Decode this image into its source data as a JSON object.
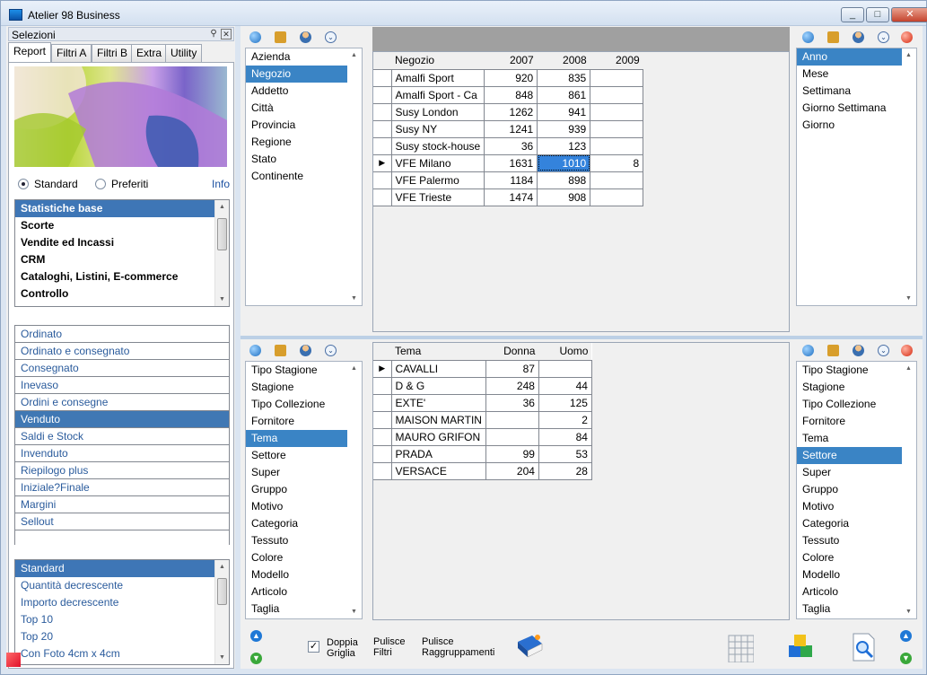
{
  "window": {
    "title": "Atelier 98 Business"
  },
  "left": {
    "header": "Selezioni",
    "tabs": [
      "Report",
      "Filtri A",
      "Filtri B",
      "Extra",
      "Utility"
    ],
    "radios": {
      "standard": "Standard",
      "preferiti": "Preferiti",
      "info": "Info"
    },
    "categories": [
      "Statistiche base",
      "Scorte",
      "Vendite ed Incassi",
      "CRM",
      "Cataloghi, Listini, E-commerce",
      "Controllo"
    ],
    "reports": [
      "Ordinato",
      "Ordinato e consegnato",
      "Consegnato",
      "Inevaso",
      "Ordini e consegne",
      "Venduto",
      "Saldi e Stock",
      "Invenduto",
      "Riepilogo plus",
      "Iniziale?Finale",
      "Margini",
      "Sellout"
    ],
    "sorts": [
      "Standard",
      "Quantità decrescente",
      "Importo decrescente",
      "Top 10",
      "Top 20",
      "Con Foto 4cm x 4cm"
    ]
  },
  "top": {
    "row_fields": [
      "Azienda",
      "Negozio",
      "Addetto",
      "Città",
      "Provincia",
      "Regione",
      "Stato",
      "Continente"
    ],
    "col_fields": [
      "Anno",
      "Mese",
      "Settimana",
      "Giorno Settimana",
      "Giorno"
    ],
    "grid": {
      "headers": [
        "Negozio",
        "2007",
        "2008",
        "2009"
      ],
      "rows": [
        [
          "Amalfi Sport",
          "920",
          "835",
          ""
        ],
        [
          "Amalfi Sport - Ca",
          "848",
          "861",
          ""
        ],
        [
          "Susy London",
          "1262",
          "941",
          ""
        ],
        [
          "Susy NY",
          "1241",
          "939",
          ""
        ],
        [
          "Susy stock-house",
          "36",
          "123",
          ""
        ],
        [
          "VFE Milano",
          "1631",
          "1010",
          "8"
        ],
        [
          "VFE Palermo",
          "1184",
          "898",
          ""
        ],
        [
          "VFE Trieste",
          "1474",
          "908",
          ""
        ]
      ]
    }
  },
  "bottom": {
    "row_fields": [
      "Tipo Stagione",
      "Stagione",
      "Tipo Collezione",
      "Fornitore",
      "Tema",
      "Settore",
      "Super",
      "Gruppo",
      "Motivo",
      "Categoria",
      "Tessuto",
      "Colore",
      "Modello",
      "Articolo",
      "Taglia"
    ],
    "col_fields": [
      "Tipo Stagione",
      "Stagione",
      "Tipo Collezione",
      "Fornitore",
      "Tema",
      "Settore",
      "Super",
      "Gruppo",
      "Motivo",
      "Categoria",
      "Tessuto",
      "Colore",
      "Modello",
      "Articolo",
      "Taglia"
    ],
    "grid": {
      "headers": [
        "Tema",
        "Donna",
        "Uomo"
      ],
      "rows": [
        [
          "CAVALLI",
          "87",
          ""
        ],
        [
          "D & G",
          "248",
          "44"
        ],
        [
          "EXTE'",
          "36",
          "125"
        ],
        [
          "MAISON MARTIN",
          "",
          "2"
        ],
        [
          "MAURO GRIFON",
          "",
          "84"
        ],
        [
          "PRADA",
          "99",
          "53"
        ],
        [
          "VERSACE",
          "204",
          "28"
        ]
      ]
    }
  },
  "toolbar": {
    "doppia1": "Doppia",
    "doppia2": "Griglia",
    "pulisce_filtri1": "Pulisce",
    "pulisce_filtri2": "Filtri",
    "pulisce_raggr1": "Pulisce",
    "pulisce_raggr2": "Raggruppamenti"
  },
  "icons": [
    "globe-icon",
    "box-icon",
    "user-icon",
    "dropdown-icon",
    "record-icon",
    "arrow-up-icon",
    "arrow-down-icon",
    "book-icon",
    "grid-icon",
    "cubes-icon",
    "search-doc-icon"
  ],
  "colors": {
    "selection": "#3a84c5",
    "grid_cursor": "#3483dc",
    "link": "#2a5b9c"
  }
}
